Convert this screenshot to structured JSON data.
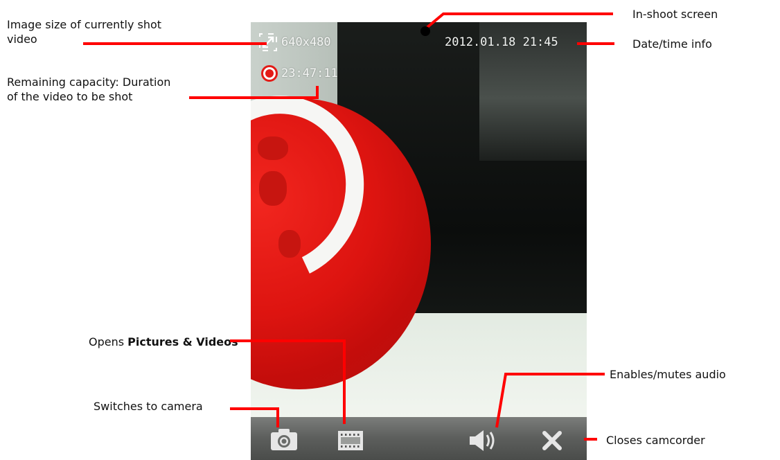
{
  "screen": {
    "resolution": "640x480",
    "remaining_time": "23:47:11",
    "datetime": "2012.01.18 21:45"
  },
  "toolbar": {
    "camera_icon": "camera-icon",
    "pictures_icon": "film-strip-icon",
    "audio_icon": "speaker-icon",
    "close_icon": "close-icon"
  },
  "callouts": {
    "image_size_line1": "Image size of currently shot",
    "image_size_line2": "video",
    "remaining_line1": "Remaining capacity: Duration",
    "remaining_line2": "of the video to be shot",
    "in_shoot": "In-shoot screen",
    "date_time": "Date/time info",
    "opens_prefix": "Opens ",
    "opens_bold": "Pictures & Videos",
    "switch_camera": "Switches to camera",
    "audio": "Enables/mutes audio",
    "close": "Closes camcorder"
  },
  "colors": {
    "callout_line": "#ff0000",
    "rec_red": "#e31b17"
  }
}
